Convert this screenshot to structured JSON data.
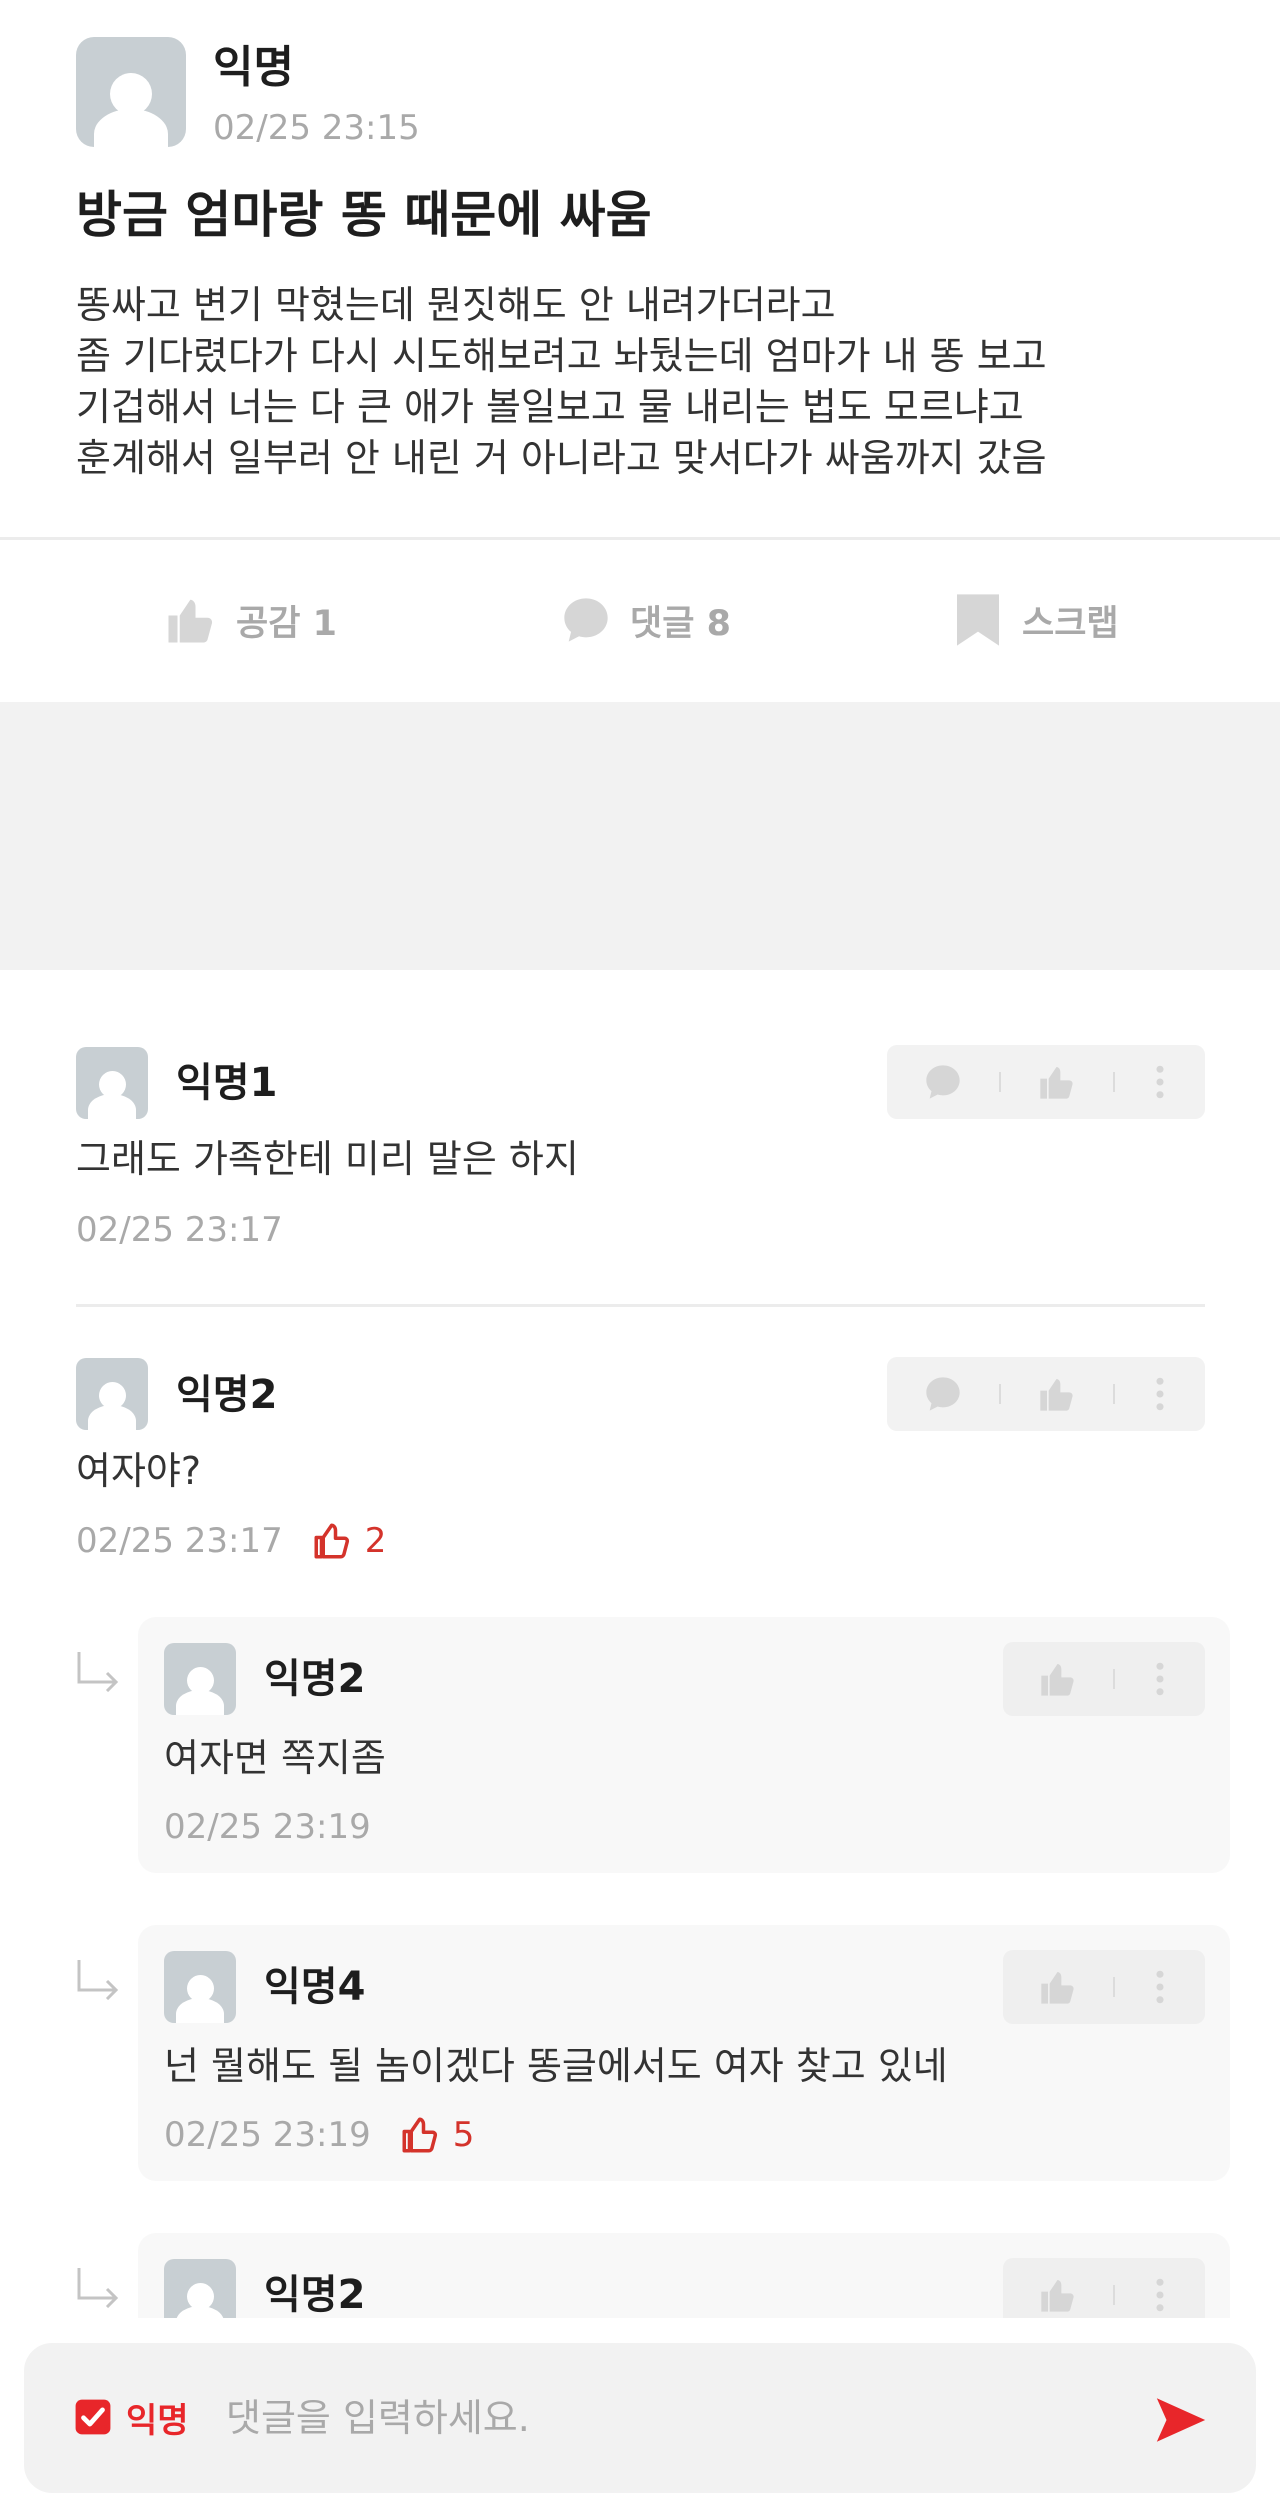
{
  "post": {
    "author": "익명",
    "time": "02/25 23:15",
    "title": "방금 엄마랑 똥 때문에 싸움",
    "body": [
      "똥싸고 변기 막혔는데 뭔짓해도 안 내려가더라고",
      "좀 기다렸다가 다시 시도해보려고 놔뒀는데 엄마가 내 똥 보고",
      "기겁해서 너는 다 큰 애가 볼일보고 물 내리는 법도 모르냐고",
      "훈계해서 일부러 안 내린 거 아니라고 맞서다가 싸움까지 갔음"
    ]
  },
  "actions": {
    "like_label": "공감 1",
    "comment_label": "댓글 8",
    "scrap_label": "스크랩"
  },
  "comments": [
    {
      "author": "익명1",
      "text": "그래도 가족한테 미리 말은 하지",
      "time": "02/25 23:17",
      "likes": null
    },
    {
      "author": "익명2",
      "text": "여자야?",
      "time": "02/25 23:17",
      "likes": "2"
    }
  ],
  "replies": [
    {
      "author": "익명2",
      "text": "여자면 쪽지좀",
      "time": "02/25 23:19",
      "likes": null
    },
    {
      "author": "익명4",
      "text": "넌 뭘해도 될 놈이겠다 똥글에서도 여자 찾고 있네",
      "time": "02/25 23:19",
      "likes": "5"
    },
    {
      "author": "익명2"
    }
  ],
  "input": {
    "anon_label": "익명",
    "placeholder": "댓글을 입력하세요."
  },
  "colors": {
    "accent": "#e8262a",
    "like_red": "#d4332b",
    "muted": "#a9a9a9"
  }
}
